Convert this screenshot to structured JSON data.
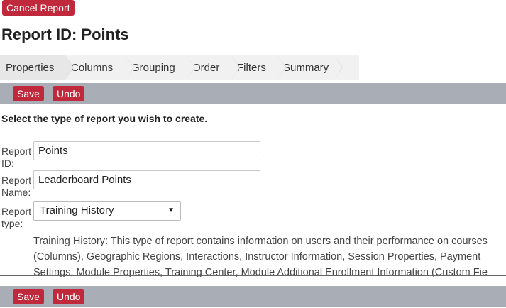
{
  "header": {
    "cancel_label": "Cancel Report",
    "title": "Report ID: Points"
  },
  "tabs": [
    {
      "label": "Properties",
      "active": true
    },
    {
      "label": "Columns"
    },
    {
      "label": "Grouping"
    },
    {
      "label": "Order"
    },
    {
      "label": "Filters"
    },
    {
      "label": "Summary"
    }
  ],
  "toolbar": {
    "save_label": "Save",
    "undo_label": "Undo"
  },
  "form": {
    "instruction": "Select the type of report you wish to create.",
    "report_id": {
      "label_line1": "Report",
      "label_line2": "ID:",
      "value": "Points"
    },
    "report_name": {
      "label_line1": "Report",
      "label_line2": "Name:",
      "value": "Leaderboard Points"
    },
    "report_type": {
      "label_line1": "Report",
      "label_line2": "type:",
      "selected": "Training History"
    },
    "description_lines": [
      "Training History: This type of report contains information on users and their performance on courses",
      "(Columns), Geographic Regions, Interactions, Instructor Information, Session Properties, Payment",
      "Settings, Module Properties, Training Center, Module Additional Enrollment Information (Custom Fie"
    ]
  },
  "colors": {
    "accent_red": "#c0283b",
    "toolbar_gray": "#a9adb5",
    "tab_bg": "#f1f1f1"
  }
}
